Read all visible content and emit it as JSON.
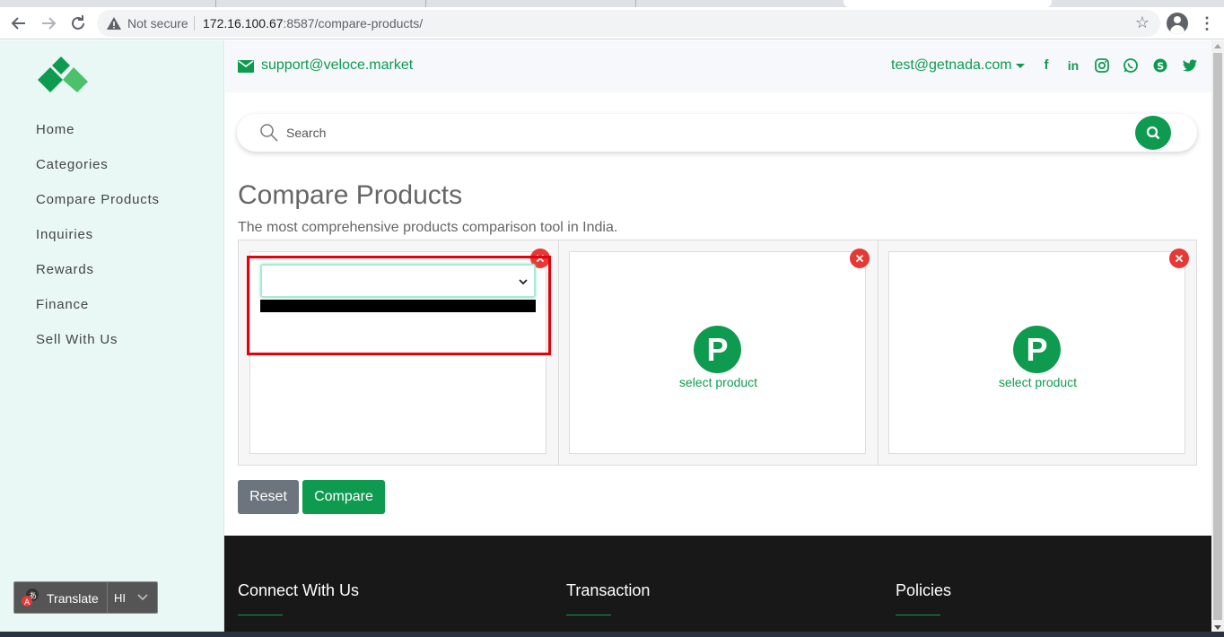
{
  "browser": {
    "security_label": "Not secure",
    "url_host": "172.16.100.67",
    "url_path": ":8587/compare-products/"
  },
  "sidebar": {
    "items": [
      {
        "label": "Home"
      },
      {
        "label": "Categories"
      },
      {
        "label": "Compare Products"
      },
      {
        "label": "Inquiries"
      },
      {
        "label": "Rewards"
      },
      {
        "label": "Finance"
      },
      {
        "label": "Sell With Us"
      }
    ],
    "translate": {
      "label": "Translate",
      "language": "HI"
    }
  },
  "topbar": {
    "support_email": "support@veloce.market",
    "account_email": "test@getnada.com",
    "social": [
      "facebook-icon",
      "linkedin-icon",
      "instagram-icon",
      "whatsapp-icon",
      "skype-icon",
      "twitter-icon"
    ]
  },
  "search": {
    "placeholder": "Search"
  },
  "page": {
    "title": "Compare Products",
    "subtitle": "The most comprehensive products comparison tool in India."
  },
  "compare": {
    "slots": [
      {
        "state": "dropdown-open",
        "selected": ""
      },
      {
        "badge": "P",
        "link": "select product"
      },
      {
        "badge": "P",
        "link": "select product"
      }
    ],
    "reset_label": "Reset",
    "compare_label": "Compare"
  },
  "footer": {
    "columns": [
      "Connect With Us",
      "Transaction",
      "Policies"
    ]
  },
  "colors": {
    "accent": "#0e9b4f",
    "danger": "#e53935",
    "highlight": "#e8000b",
    "sidebar_bg": "#e9f8f4",
    "footer_bg": "#181818"
  }
}
